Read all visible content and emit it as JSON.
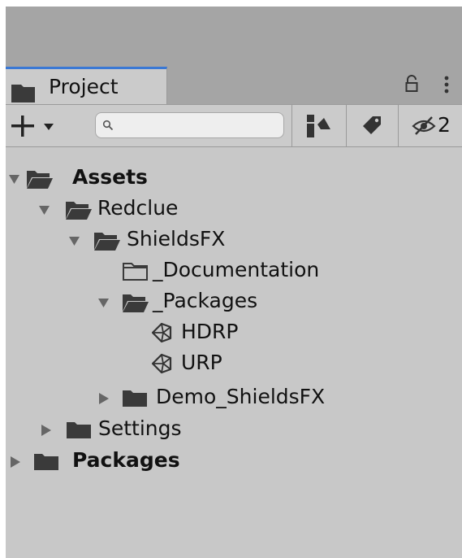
{
  "tab": {
    "label": "Project"
  },
  "toolbar": {
    "search": {
      "value": "",
      "placeholder": ""
    },
    "hidden_count": "2"
  },
  "tree": [
    {
      "label": "Assets",
      "bold": true,
      "depth": 0,
      "expanded": true,
      "kind": "folder-open"
    },
    {
      "label": "Redclue",
      "bold": false,
      "depth": 1,
      "expanded": true,
      "kind": "folder-open"
    },
    {
      "label": "ShieldsFX",
      "bold": false,
      "depth": 2,
      "expanded": true,
      "kind": "folder-open"
    },
    {
      "label": "_Documentation",
      "bold": false,
      "depth": 3,
      "expanded": null,
      "kind": "folder-empty"
    },
    {
      "label": "_Packages",
      "bold": false,
      "depth": 3,
      "expanded": true,
      "kind": "folder-open"
    },
    {
      "label": "HDRP",
      "bold": false,
      "depth": 4,
      "expanded": null,
      "kind": "unity-asset"
    },
    {
      "label": "URP",
      "bold": false,
      "depth": 4,
      "expanded": null,
      "kind": "unity-asset"
    },
    {
      "label": "Demo_ShieldsFX",
      "bold": false,
      "depth": 3,
      "expanded": false,
      "kind": "folder-closed"
    },
    {
      "label": "Settings",
      "bold": false,
      "depth": 1,
      "expanded": false,
      "kind": "folder-closed"
    },
    {
      "label": "Packages",
      "bold": true,
      "depth": 0,
      "expanded": false,
      "kind": "folder-closed"
    }
  ],
  "colors": {
    "accent": "#3a78d4",
    "panel": "#c8c8c8",
    "header": "#a5a5a5",
    "icon": "#3a3a3a"
  }
}
